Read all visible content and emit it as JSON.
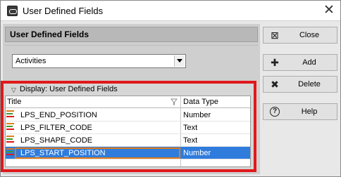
{
  "window": {
    "title": "User Defined Fields",
    "close_glyph": "✕"
  },
  "panel": {
    "header": "User Defined Fields"
  },
  "dropdown": {
    "selected": "Activities"
  },
  "group": {
    "label": "Display: User Defined Fields"
  },
  "table": {
    "columns": [
      "Title",
      "Data Type"
    ],
    "rows": [
      {
        "title": "LPS_END_POSITION",
        "type": "Number",
        "selected": false
      },
      {
        "title": "LPS_FILTER_CODE",
        "type": "Text",
        "selected": false
      },
      {
        "title": "LPS_SHAPE_CODE",
        "type": "Text",
        "selected": false
      },
      {
        "title": "LPS_START_POSITION",
        "type": "Number",
        "selected": true
      }
    ]
  },
  "buttons": {
    "close": {
      "label": "Close",
      "icon": "close-panel-icon",
      "glyph": "⊠"
    },
    "add": {
      "label": "Add",
      "icon": "plus-icon",
      "glyph": "✚"
    },
    "delete": {
      "label": "Delete",
      "icon": "delete-x-icon",
      "glyph": "✖"
    },
    "help": {
      "label": "Help",
      "icon": "help-icon",
      "glyph": "?"
    }
  },
  "colors": {
    "selection": "#2f7cdc",
    "highlight_frame": "#e0181b",
    "focus": "#e07b1a"
  }
}
